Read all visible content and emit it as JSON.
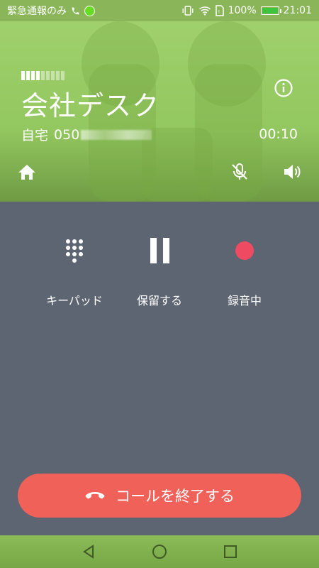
{
  "status_bar": {
    "left_text": "緊急通報のみ",
    "battery": "100%",
    "time": "21:01",
    "icons": [
      "phone-icon",
      "green-dot-icon",
      "vibrate-icon",
      "wifi-icon",
      "sim-icon",
      "battery-icon"
    ]
  },
  "call": {
    "signal_level": 0.45,
    "contact_name": "会社デスク",
    "number_label": "自宅",
    "number_prefix": "050",
    "timer": "00:10"
  },
  "controls": [
    {
      "label": "キーパッド",
      "icon": "keypad-icon"
    },
    {
      "label": "保留する",
      "icon": "pause-icon"
    },
    {
      "label": "録音中",
      "icon": "record-icon"
    }
  ],
  "end_call": {
    "label": "コールを終了する",
    "icon": "hangup-icon"
  },
  "colors": {
    "header_green": "#9fd06c",
    "control_bg": "#5d6572",
    "end_call_red": "#f06159",
    "record_red": "#ee4b62"
  },
  "nav_icons": [
    "back-icon",
    "home-icon",
    "recents-icon"
  ]
}
